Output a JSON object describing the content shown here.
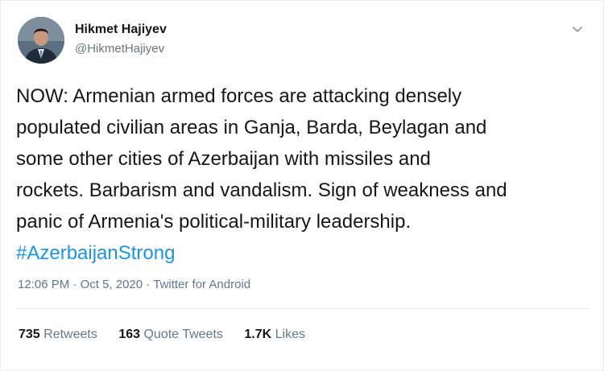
{
  "author": {
    "name": "Hikmet Hajiyev",
    "handle": "@HikmetHajiyev"
  },
  "tweet": {
    "lines": [
      "NOW: Armenian armed forces are attacking densely",
      "populated civilian areas in Ganja, Barda, Beylagan and",
      "some other cities of Azerbaijan with missiles and",
      "rockets. Barbarism and vandalism. Sign of weakness and",
      "panic of Armenia's political-military leadership."
    ],
    "hashtag": "#AzerbaijanStrong"
  },
  "meta": {
    "time": "12:06 PM",
    "separator": "·",
    "date": "Oct 5, 2020",
    "source": "Twitter for Android"
  },
  "stats": {
    "retweets_count": "735",
    "retweets_label": "Retweets",
    "quotes_count": "163",
    "quotes_label": "Quote Tweets",
    "likes_count": "1.7K",
    "likes_label": "Likes"
  },
  "icons": {
    "menu": "chevron-down-icon"
  },
  "colors": {
    "text": "#14171a",
    "secondary": "#657786",
    "link": "#1b95e0",
    "border": "#e6ecf0"
  }
}
